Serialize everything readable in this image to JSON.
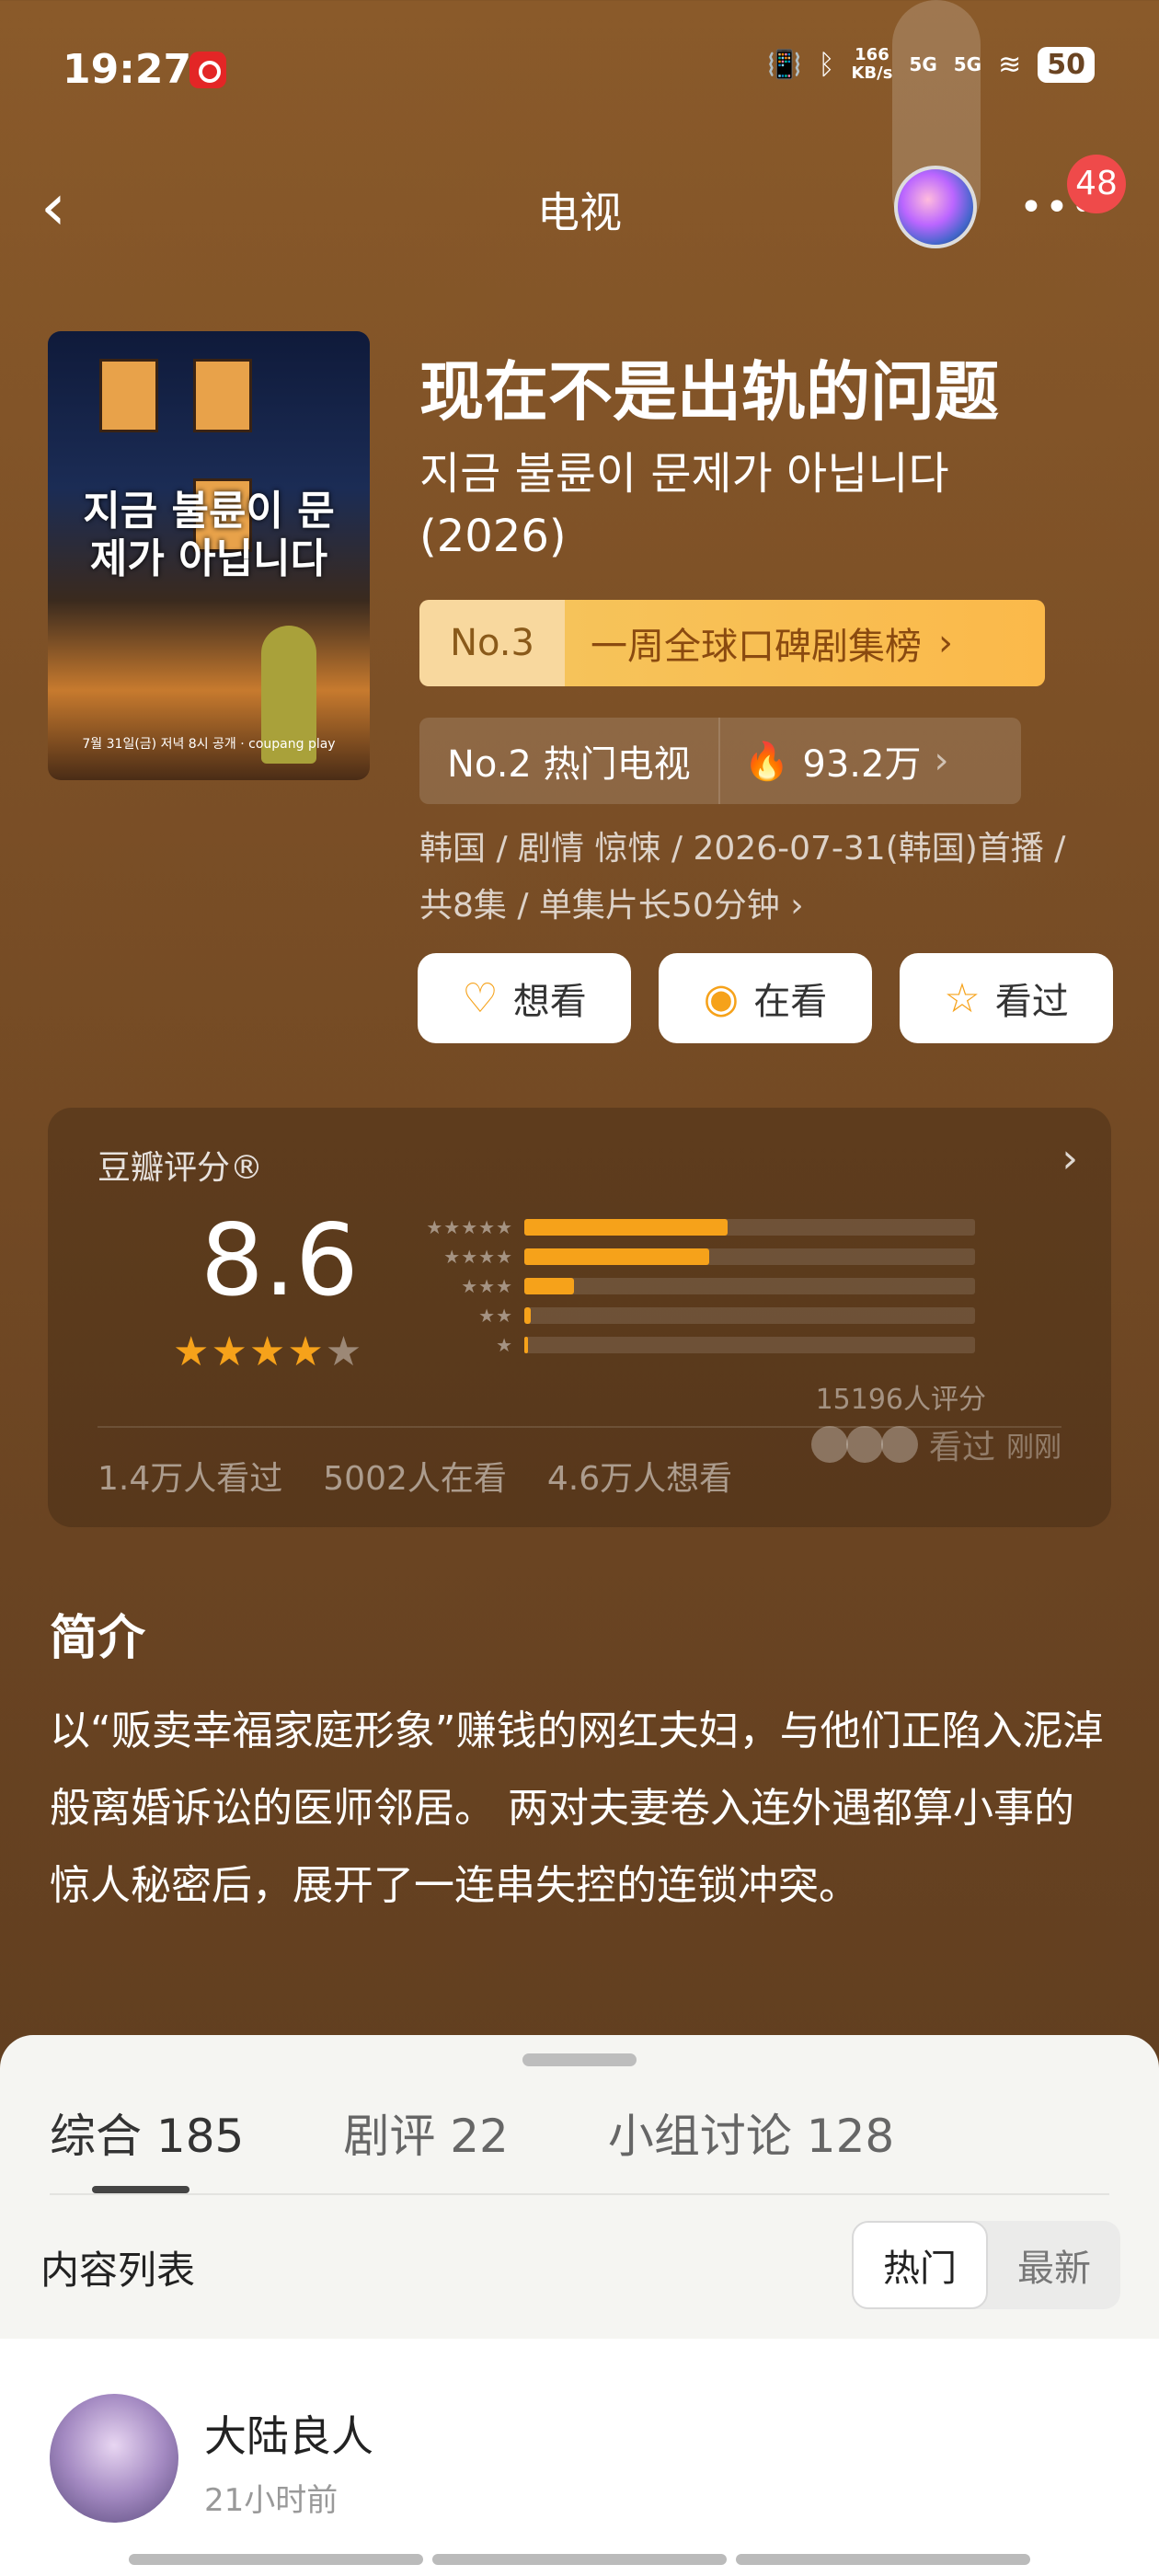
{
  "status_bar": {
    "time": "19:27",
    "speed_top": "166",
    "speed_bottom": "KB/s",
    "sig1": "5G",
    "sig2": "5G",
    "battery": "50"
  },
  "header": {
    "title": "电视",
    "badge": "48"
  },
  "poster": {
    "title": "지금 불륜이 문제가 아닙니다",
    "footer": "7월 31일(금) 저녁 8시 공개 · coupang play"
  },
  "show": {
    "title_cn": "现在不是出轨的问题",
    "title_ko": "지금 불륜이 문제가 아닙니다",
    "year": "(2026)",
    "rank1_no": "No.3",
    "rank1_text": "一周全球口碑剧集榜",
    "rank2_text": "No.2 热门电视",
    "rank2_heat": "93.2万",
    "meta_line1": "韩国 / 剧情 惊悚 / 2026-07-31(韩国)首播 /",
    "meta_line2": "共8集 / 单集片长50分钟"
  },
  "actions": {
    "want": "想看",
    "watching": "在看",
    "watched": "看过"
  },
  "rating": {
    "label": "豆瓣评分®",
    "score": "8.6",
    "votes": "15196人评分",
    "distribution": [
      {
        "stars": "★★★★★",
        "fraction": 0.45
      },
      {
        "stars": "★★★★",
        "fraction": 0.41
      },
      {
        "stars": "★★★",
        "fraction": 0.11
      },
      {
        "stars": "★★",
        "fraction": 0.015
      },
      {
        "stars": "★",
        "fraction": 0.008
      }
    ],
    "watched_count": "1.4万人看过",
    "watching_count": "5002人在看",
    "want_count": "4.6万人想看",
    "friend_label": "看过",
    "friend_time": "刚刚"
  },
  "summary": {
    "heading": "简介",
    "text": "以“贩卖幸福家庭形象”赚钱的网红夫妇，与他们正陷入泥淖般离婚诉讼的医师邻居。 两对夫妻卷入连外遇都算小事的惊人秘密后，展开了一连串失控的连锁冲突。"
  },
  "sheet": {
    "tabs": [
      "综合 185",
      "剧评 22",
      "小组讨论 128"
    ],
    "list_title": "内容列表",
    "sort_hot": "热门",
    "sort_new": "最新",
    "post": {
      "user": "大陆良人",
      "time": "21小时前"
    }
  },
  "colors": {
    "accent": "#f6a21a",
    "background": "#7b4f26",
    "badge": "#ef4a4a"
  }
}
